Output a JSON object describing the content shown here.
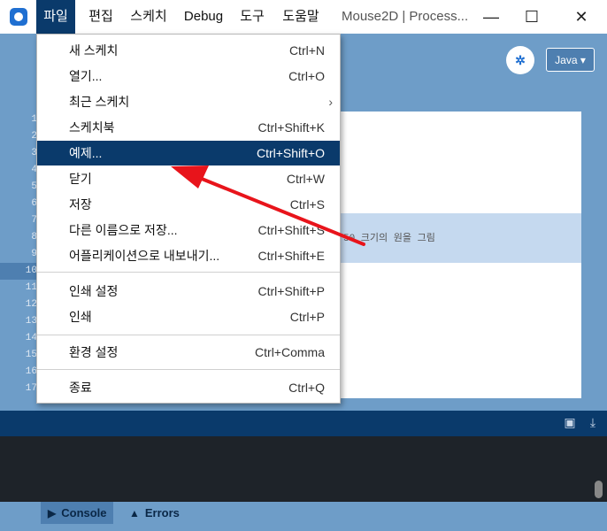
{
  "menubar": {
    "items": [
      {
        "label": "파일",
        "active": true
      },
      {
        "label": "편집"
      },
      {
        "label": "스케치"
      },
      {
        "label": "Debug"
      },
      {
        "label": "도구"
      },
      {
        "label": "도움말"
      }
    ],
    "window_title": "Mouse2D | Process..."
  },
  "window_controls": {
    "minimize": "—",
    "maximize": "☐",
    "close": "✕"
  },
  "toolbar": {
    "mode_label": "Java ▾"
  },
  "editor": {
    "line_numbers": [
      "1",
      "2",
      "3",
      "4",
      "5",
      "6",
      "7",
      "8",
      "9",
      "10",
      "11",
      "12",
      "13",
      "14",
      "15",
      "16",
      "17"
    ],
    "current_line": "10",
    "visible_code_fragment": "50 크기의 원을 그림"
  },
  "file_menu": {
    "items": [
      {
        "label": "새 스케치",
        "shortcut": "Ctrl+N"
      },
      {
        "label": "열기...",
        "shortcut": "Ctrl+O"
      },
      {
        "label": "최근 스케치",
        "shortcut": "",
        "submenu": true
      },
      {
        "label": "스케치북",
        "shortcut": "Ctrl+Shift+K"
      },
      {
        "label": "예제...",
        "shortcut": "Ctrl+Shift+O",
        "highlighted": true
      },
      {
        "label": "닫기",
        "shortcut": "Ctrl+W"
      },
      {
        "label": "저장",
        "shortcut": "Ctrl+S"
      },
      {
        "label": "다른 이름으로 저장...",
        "shortcut": "Ctrl+Shift+S"
      },
      {
        "label": "어플리케이션으로 내보내기...",
        "shortcut": "Ctrl+Shift+E"
      },
      {
        "label": "인쇄 설정",
        "shortcut": "Ctrl+Shift+P"
      },
      {
        "label": "인쇄",
        "shortcut": "Ctrl+P"
      },
      {
        "label": "환경 설정",
        "shortcut": "Ctrl+Comma"
      },
      {
        "label": "종료",
        "shortcut": "Ctrl+Q"
      }
    ]
  },
  "bottom_tabs": {
    "console": "Console",
    "errors": "Errors"
  },
  "annotation": {
    "arrow_color": "#e8141b"
  },
  "colors": {
    "accent": "#0a3a6b",
    "editor_bg": "#ffffff",
    "ui_bg": "#6e9dc8",
    "current_line": "#c5d9ef"
  }
}
